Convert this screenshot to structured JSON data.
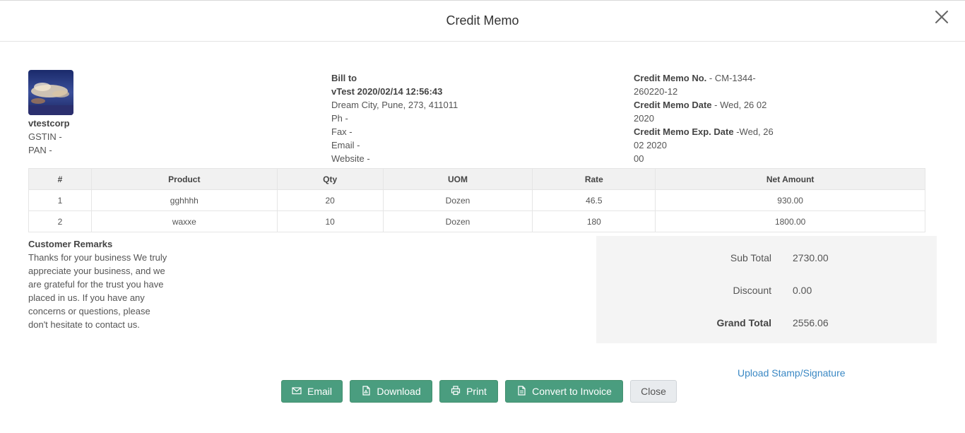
{
  "modal": {
    "title": "Credit Memo"
  },
  "company": {
    "name": "vtestcorp",
    "gstin": "GSTIN -",
    "pan": "PAN -"
  },
  "bill_to": {
    "heading": "Bill to",
    "name": "vTest 2020/02/14 12:56:43",
    "address": "Dream City, Pune, 273, 411011",
    "phone": "Ph -",
    "fax": "Fax -",
    "email": "Email -",
    "website": "Website -"
  },
  "memo_info": {
    "no_label": "Credit Memo No.",
    "no_value_1": "- CM-1344-",
    "no_value_2": "260220-12",
    "date_label": "Credit Memo Date",
    "date_value_1": "- Wed, 26 02",
    "date_value_2": "2020",
    "exp_label": "Credit Memo Exp. Date",
    "exp_value_1": "-Wed, 26",
    "exp_value_2": "02 2020",
    "exp_value_3": "00"
  },
  "table": {
    "headers": [
      "#",
      "Product",
      "Qty",
      "UOM",
      "Rate",
      "Net Amount"
    ],
    "rows": [
      [
        "1",
        "gghhhh",
        "20",
        "Dozen",
        "46.5",
        "930.00"
      ],
      [
        "2",
        "waxxe",
        "10",
        "Dozen",
        "180",
        "1800.00"
      ]
    ]
  },
  "remarks": {
    "heading": "Customer Remarks",
    "lines": [
      "Thanks for your business We truly",
      "appreciate your business, and we",
      "are grateful for the trust you have",
      "placed in us. If you have any",
      "concerns or questions, please",
      "don't hesitate to contact us."
    ]
  },
  "totals": {
    "sub_total_label": "Sub Total",
    "sub_total_value": "2730.00",
    "discount_label": "Discount",
    "discount_value": "0.00",
    "grand_total_label": "Grand Total",
    "grand_total_value": "2556.06"
  },
  "links": {
    "upload": "Upload Stamp/Signature"
  },
  "buttons": {
    "email": "Email",
    "download": "Download",
    "print": "Print",
    "convert": "Convert to Invoice",
    "close": "Close"
  },
  "icons": {
    "close": "close-icon",
    "email": "envelope-icon",
    "download": "pdf-file-icon",
    "print": "printer-icon",
    "convert": "document-icon"
  },
  "colors": {
    "primary_button": "#4a9d7f",
    "link": "#3a88c4",
    "totals_bg": "#f4f4f4"
  }
}
